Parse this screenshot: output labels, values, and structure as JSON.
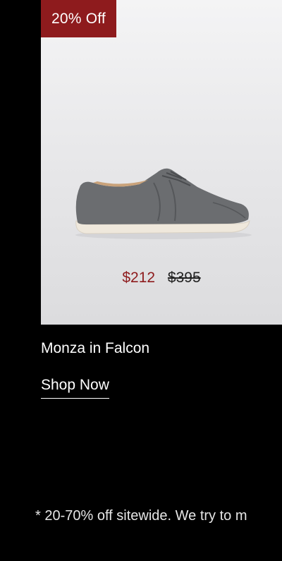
{
  "product": {
    "badge": "20% Off",
    "sale_price": "$212",
    "original_price": "$395",
    "name": "Monza in Falcon",
    "cta_label": "Shop Now",
    "shoe_colors": {
      "upper": "#6b6d70",
      "sole": "#efe8dc",
      "accent_badge": "#8e1b1d"
    }
  },
  "footnote": "* 20-70% off sitewide. We try to m"
}
